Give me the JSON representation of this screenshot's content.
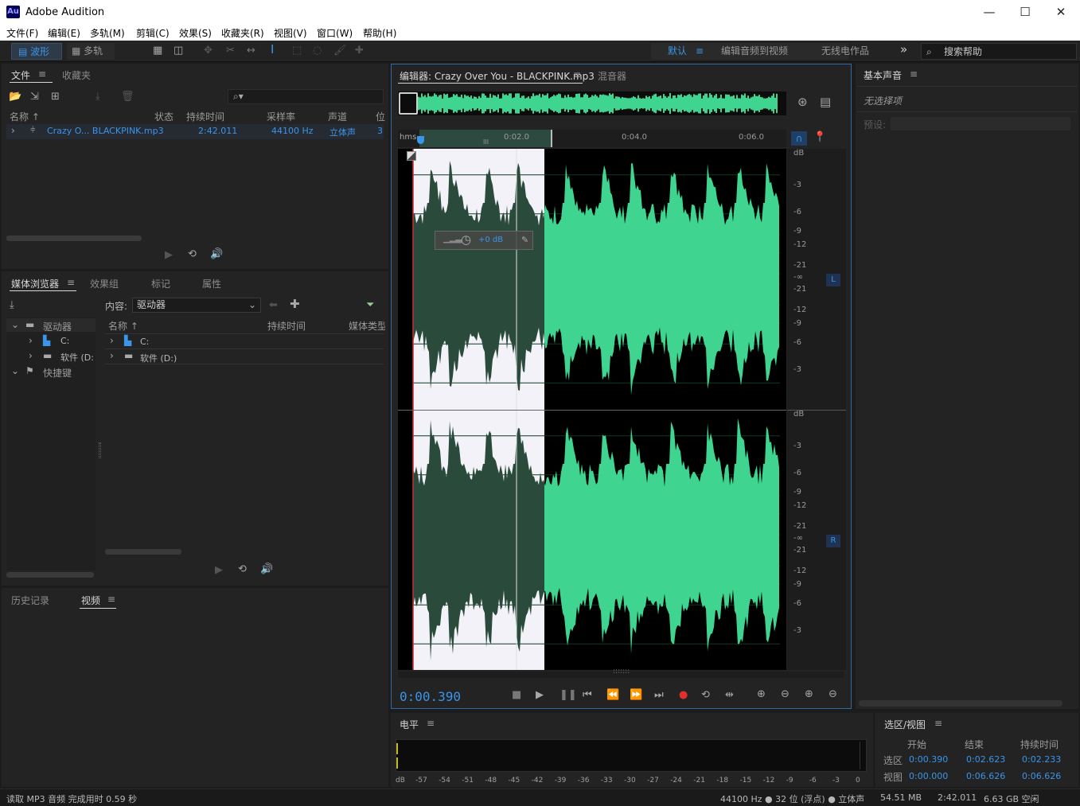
{
  "app": {
    "title": "Adobe Audition",
    "logo": "Au"
  },
  "window_controls": {
    "minimize": "—",
    "maximize": "☐",
    "close": "✕"
  },
  "menu": [
    "文件(F)",
    "编辑(E)",
    "多轨(M)",
    "剪辑(C)",
    "效果(S)",
    "收藏夹(R)",
    "视图(V)",
    "窗口(W)",
    "帮助(H)"
  ],
  "toolbar": {
    "waveform_label": "波形",
    "multitrack_label": "多轨",
    "workspaces": [
      "默认",
      "编辑音频到视频",
      "无线电作品"
    ],
    "more": "»",
    "search_placeholder": "搜索帮助"
  },
  "files_panel": {
    "tabs": [
      "文件",
      "收藏夹"
    ],
    "columns": [
      "名称 ↑",
      "状态",
      "持续时间",
      "采样率",
      "声道",
      "位"
    ],
    "rows": [
      {
        "name": "Crazy O... BLACKPINK.mp3",
        "duration": "2:42.011",
        "rate": "44100 Hz",
        "channels": "立体声",
        "bits": "3"
      }
    ]
  },
  "media_browser": {
    "tabs": [
      "媒体浏览器",
      "效果组",
      "标记",
      "属性"
    ],
    "content_label": "内容:",
    "content_value": "驱动器",
    "tree": [
      {
        "label": "驱动器",
        "level": 0,
        "expanded": true
      },
      {
        "label": "C:",
        "level": 1
      },
      {
        "label": "软件 (D:",
        "level": 1
      },
      {
        "label": "快捷键",
        "level": 0,
        "expanded": true
      }
    ],
    "columns": [
      "名称 ↑",
      "持续时间",
      "媒体类型"
    ],
    "rows": [
      {
        "name": "C:"
      },
      {
        "name": "软件 (D:)"
      }
    ]
  },
  "history_panel": {
    "tabs": [
      "历史记录",
      "视频"
    ]
  },
  "editor": {
    "tabs": [
      "编辑器: Crazy Over You - BLACKPINK.mp3",
      "混音器"
    ],
    "ruler_labels": [
      "hms",
      "0:02.0",
      "0:04.0",
      "0:06.0"
    ],
    "hud_gain": "+0 dB",
    "db_scale_top": [
      "dB",
      "-3",
      "-6",
      "-9",
      "-12",
      "-21",
      "-∞",
      "-21",
      "-12",
      "-9",
      "-6",
      "-3"
    ],
    "db_scale_bottom": [
      "dB",
      "-3",
      "-6",
      "-9",
      "-12",
      "-21",
      "-∞",
      "-21",
      "-12",
      "-9",
      "-6",
      "-3"
    ],
    "channel_left": "L",
    "channel_right": "R",
    "current_time": "0:00.390",
    "colors": {
      "wave": "#3fd48f",
      "wave_sel": "#2a4a3b",
      "selection": "#f2f2f8",
      "accent": "#3b95e8",
      "record": "#e0302e"
    }
  },
  "essential_sound": {
    "title": "基本声音",
    "no_selection": "无选择项",
    "preset_label": "预设:"
  },
  "level_meter": {
    "title": "电平",
    "scale": [
      "dB",
      "-57",
      "-54",
      "-51",
      "-48",
      "-45",
      "-42",
      "-39",
      "-36",
      "-33",
      "-30",
      "-27",
      "-24",
      "-21",
      "-18",
      "-15",
      "-12",
      "-9",
      "-6",
      "-3",
      "0"
    ]
  },
  "selection_view": {
    "title": "选区/视图",
    "headers": [
      "开始",
      "结束",
      "持续时间"
    ],
    "rows": [
      {
        "label": "选区",
        "start": "0:00.390",
        "end": "0:02.623",
        "duration": "0:02.233"
      },
      {
        "label": "视图",
        "start": "0:00.000",
        "end": "0:06.626",
        "duration": "0:06.626"
      }
    ]
  },
  "status_bar": {
    "message": "读取 MP3 音频 完成用时 0.59 秒",
    "format": "44100 Hz ● 32 位 (浮点) ● 立体声",
    "size": "54.51 MB",
    "duration": "2:42.011",
    "free": "6.63 GB 空闲"
  }
}
